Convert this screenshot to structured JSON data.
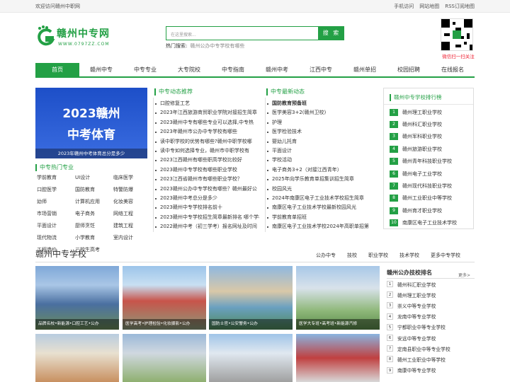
{
  "topbar": {
    "welcome": "欢迎访问赣州中职网",
    "links": [
      "手机访问",
      "网站地图",
      "RSS订阅地图"
    ]
  },
  "logo": {
    "name": "赣州中专网",
    "domain": "WWW.0797ZZ.COM"
  },
  "search": {
    "placeholder": "在这里搜索...",
    "button": "搜 索",
    "hot_label": "热门搜索:",
    "hot_keyword": "赣州公办中专学校有哪些"
  },
  "qr": {
    "caption": "微信扫一扫关注"
  },
  "nav": [
    "首页",
    "赣州中专",
    "中专专业",
    "大专院校",
    "中专指南",
    "赣州中考",
    "江西中专",
    "赣州单招",
    "校园招聘",
    "在线报名"
  ],
  "banner": {
    "line1": "2023赣州",
    "line2": "中考体育",
    "caption": "2023年赣州中考体育总分是多少"
  },
  "hot_majors": {
    "title": "中专热门专业",
    "items": [
      "学前教育",
      "UI设计",
      "临床医学",
      "口腔医学",
      "国防教育",
      "特警防爆",
      "幼师",
      "计算机应用",
      "化妆美容",
      "市场营销",
      "电子商务",
      "网络工程",
      "平面设计",
      "厨师烹饪",
      "建筑工程",
      "现代物流",
      "小学教育",
      "室内设计",
      "工程造价",
      "三校生高考"
    ]
  },
  "news_recommend": {
    "title": "中专动态推荐",
    "items": [
      "口腔修复工艺",
      "2023年江西旅游商贸职业学院对接招生简章",
      "2023赣州中专有哪些专业可以选择,中专热",
      "2023年赣州市公办中专学校有哪些",
      "读中职学校的优势有哪些?赣州中职学校哪",
      "读中专如何选择专业，赣州市中职学校有",
      "2023江西赣州有哪些职高学校比较好",
      "2023赣州中专学校有哪些职业学校",
      "2023江西省赣州市有哪些职业学校？",
      "2023赣州公办中专学校有哪些？赣州最好公",
      "2023赣州中考总分是多少",
      "2023赣州中专学校排名前十",
      "2023赣州中专学校招生简章最新排名 哪个学校比",
      "2022赣州中考（初三学考）报名网址及时间"
    ]
  },
  "news_latest": {
    "title": "中专最新动态",
    "items": [
      "国防教育预备班",
      "医学美容3+2(赣州卫校)",
      "护理",
      "医学检验技术",
      "婴幼儿托育",
      "平面设计",
      "学校活动",
      "电子商务3+2（对接江西青年）",
      "2025年向学乐教育单招集训招生简章",
      "校园风光",
      "2024年南康区电子工业技术学校招生简章",
      "南康区电子工业技术学校最新校园风光",
      "学前教育单招班",
      "南康区电子工业技术学校2024年高职单招第"
    ]
  },
  "rank": {
    "title": "赣州中专学校排行榜",
    "items": [
      "赣州理工职业学校",
      "赣州科汇职业学校",
      "赣州军科职业学校",
      "赣州旅游职业学校",
      "赣州青年科技职业学校",
      "赣州电子工业学校",
      "赣州现代科技职业学校",
      "赣州工业职业中等学校",
      "赣州育才职业学校",
      "南康区电子工业技术学校"
    ]
  },
  "schools": {
    "title": "赣州中专学校",
    "tabs": [
      "公办中专",
      "技校",
      "职业学校",
      "技术学校",
      "更多中专学校"
    ],
    "cards": [
      "品牌名校•新能源•口腔工艺•公办",
      "医学高考•护理检验•化妆摄影•公办",
      "国防士官•公安警务•公办",
      "医学大专班•高考班•新能源汽修",
      "",
      "",
      "",
      ""
    ]
  },
  "pub_rank": {
    "title": "赣州公办技校排名",
    "more": "更多>",
    "items": [
      "赣州科汇职业学校",
      "赣州理工职业学校",
      "崇义中等专业学校",
      "龙南中等专业学校",
      "宁都职业中等专业学校",
      "安远中等专业学校",
      "定南县职业中等专业学校",
      "赣州工业职业中等学校",
      "南康中等专业学校"
    ]
  },
  "colors": {
    "brand": "#23a045",
    "accent_red": "#e23333"
  }
}
